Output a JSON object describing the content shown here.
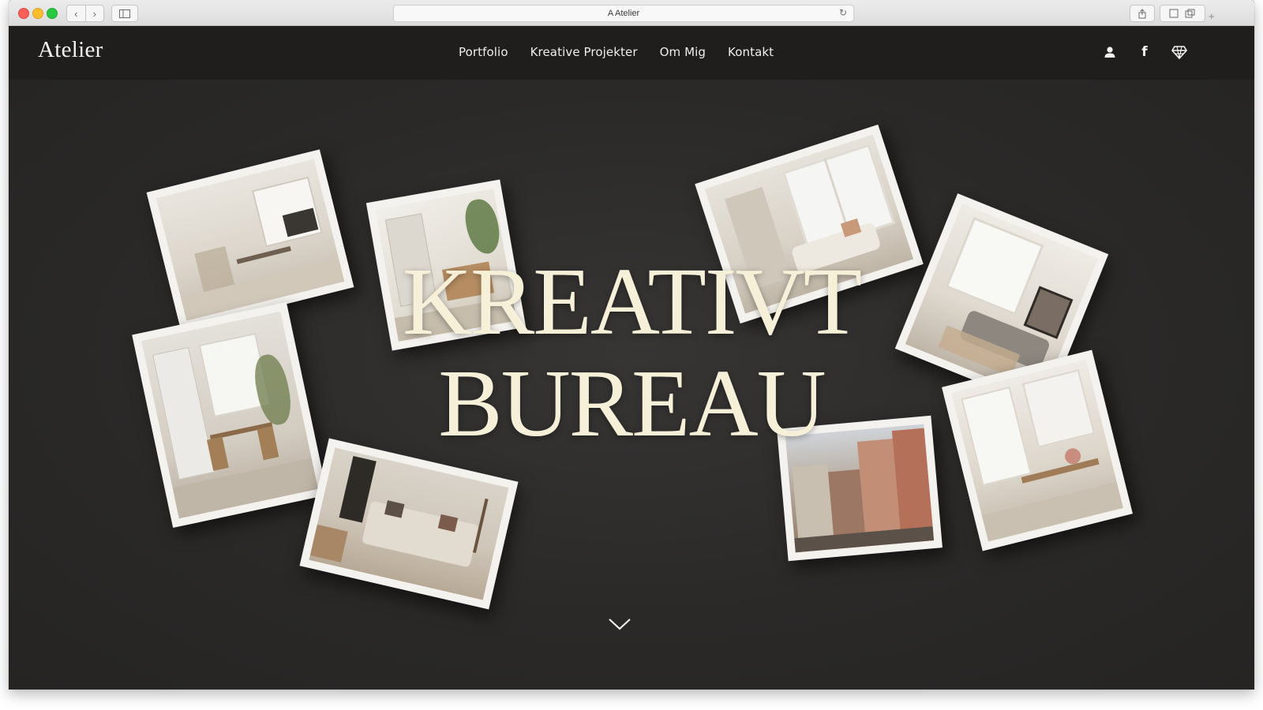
{
  "browser": {
    "address_text": "A Atelier",
    "back_glyph": "‹",
    "forward_glyph": "›",
    "reload_glyph": "↻",
    "new_tab_glyph": "+",
    "icons": [
      "sidebar-icon",
      "share-icon",
      "tabs-icon",
      "reload-icon"
    ]
  },
  "header": {
    "logo": "Atelier",
    "menu": [
      {
        "label": "Portfolio"
      },
      {
        "label": "Kreative Projekter"
      },
      {
        "label": "Om Mig"
      },
      {
        "label": "Kontakt"
      }
    ],
    "icons": [
      "user-icon",
      "facebook-icon",
      "diamond-icon"
    ],
    "facebook_glyph": "f"
  },
  "hero": {
    "title_line1": "KREATIVT",
    "title_line2": "BUREAU",
    "scroll_icon": "chevron-down-icon"
  },
  "colors": {
    "header_bg": "#1f1e1d",
    "hero_bg": "#2a2928",
    "title_color": "#f6f0d8",
    "photo_frame": "#f4f2ee"
  }
}
